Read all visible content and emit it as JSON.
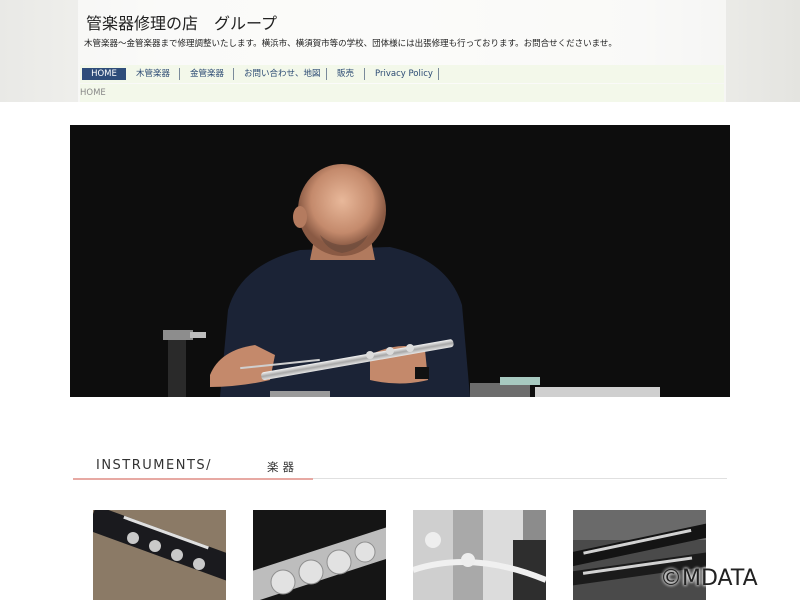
{
  "site": {
    "title": "管楽器修理の店　グループ",
    "tagline": "木管楽器～金管楽器まで修理調整いたします。横浜市、横須賀市等の学校、団体様には出張修理も行っております。お問合せくださいませ。"
  },
  "nav": {
    "items": [
      {
        "label": "HOME",
        "active": true
      },
      {
        "label": "木管楽器"
      },
      {
        "label": "金管楽器"
      },
      {
        "label": "お問い合わせ、地図"
      },
      {
        "label": "販売"
      },
      {
        "label": "Privacy Policy"
      }
    ]
  },
  "breadcrumb": {
    "label": "HOME"
  },
  "section": {
    "title": "INSTRUMENTS/",
    "subtitle": "楽器"
  },
  "thumbnails": [
    {
      "subject": "clarinet"
    },
    {
      "subject": "flute"
    },
    {
      "subject": "saxophone"
    },
    {
      "subject": "clarinet-parts"
    }
  ],
  "watermark": "©MDATA",
  "colors": {
    "nav_active": "#2f4d7a",
    "nav_text": "#2b4a73",
    "accent_rule": "#e7a9a3",
    "nav_bg": "#f3f8ea"
  }
}
